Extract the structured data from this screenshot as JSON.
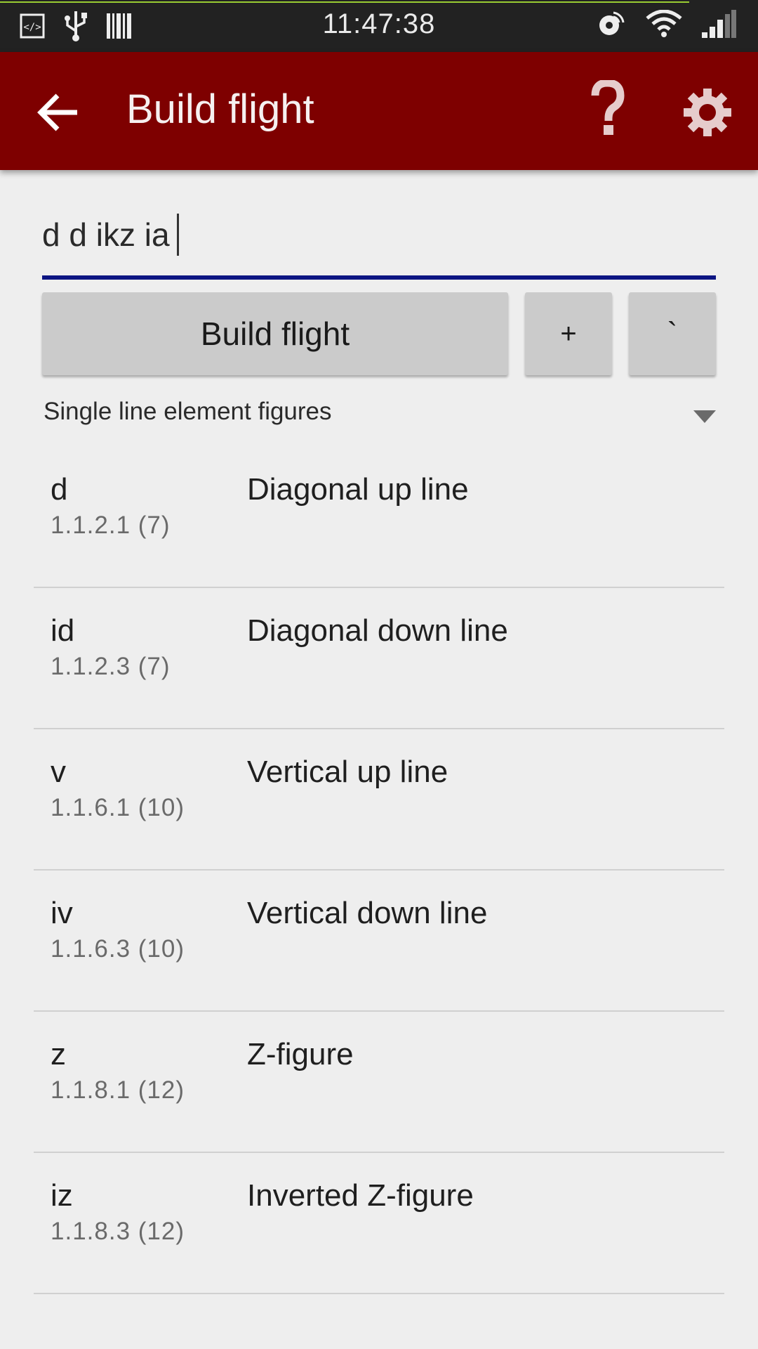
{
  "status_bar": {
    "time": "11:47:38",
    "left_icons": [
      "developer-icon",
      "usb-icon",
      "barcode-icon"
    ],
    "right_icons": [
      "hotspot-icon",
      "wifi-icon",
      "signal-icon"
    ]
  },
  "app_bar": {
    "title": "Build flight",
    "background": "#7e0000",
    "back_icon": "arrow-left-icon",
    "help_icon": "question-mark-icon",
    "settings_icon": "gear-icon"
  },
  "input": {
    "value": "d d ikz ia",
    "underline_color": "#0c1582"
  },
  "buttons": {
    "build_label": "Build flight",
    "plus_label": "+",
    "tick_label": "`"
  },
  "category": {
    "selected": "Single line element figures"
  },
  "figures": [
    {
      "code": "d",
      "ref": "1.1.2.1 (7)",
      "description": "Diagonal up line"
    },
    {
      "code": "id",
      "ref": "1.1.2.3 (7)",
      "description": "Diagonal down line"
    },
    {
      "code": "v",
      "ref": "1.1.6.1 (10)",
      "description": "Vertical up line"
    },
    {
      "code": "iv",
      "ref": "1.1.6.3 (10)",
      "description": "Vertical down line"
    },
    {
      "code": "z",
      "ref": "1.1.8.1 (12)",
      "description": "Z-figure"
    },
    {
      "code": "iz",
      "ref": "1.1.8.3 (12)",
      "description": "Inverted Z-figure"
    }
  ]
}
